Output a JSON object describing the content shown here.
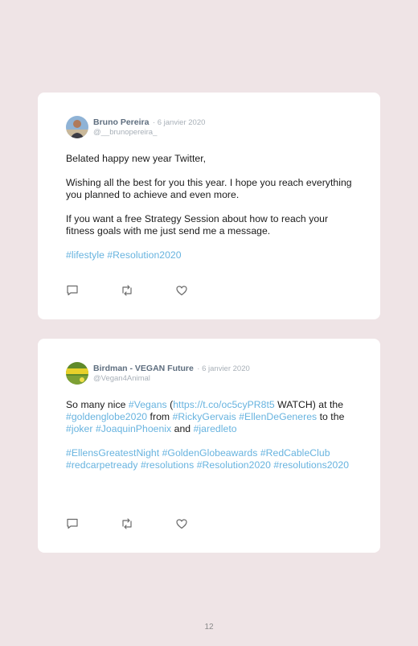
{
  "tweets": [
    {
      "name": "Bruno Pereira",
      "date": "· 6 janvier 2020",
      "handle": "@__brunopereira_",
      "paragraphs": [
        [
          {
            "t": "Belated happy new year Twitter,"
          }
        ],
        [
          {
            "t": "Wishing all the best for you this year. I hope you reach everything you planned to achieve and even more."
          }
        ],
        [
          {
            "t": "If you want a free Strategy Session about how to reach your fitness goals with me just send me a message."
          }
        ],
        [
          {
            "t": "#lifestyle",
            "tag": true
          },
          {
            "t": " "
          },
          {
            "t": "#Resolution2020",
            "tag": true
          }
        ]
      ]
    },
    {
      "name": "Birdman - VEGAN Future",
      "date": "· 6 janvier 2020",
      "handle": "@Vegan4Animal",
      "avatar_text": "VEGAN",
      "paragraphs": [
        [
          {
            "t": "So many nice "
          },
          {
            "t": "#Vegans",
            "tag": true
          },
          {
            "t": " ("
          },
          {
            "t": "https://t.co/oc5cyPR8t5",
            "tag": true
          },
          {
            "t": " WATCH) at the "
          },
          {
            "t": "#goldenglobe2020",
            "tag": true
          },
          {
            "t": " from "
          },
          {
            "t": "#RickyGervais",
            "tag": true
          },
          {
            "t": " "
          },
          {
            "t": "#EllenDeGeneres",
            "tag": true
          },
          {
            "t": " to the "
          },
          {
            "t": "#joker",
            "tag": true
          },
          {
            "t": " "
          },
          {
            "t": "#JoaquinPhoenix",
            "tag": true
          },
          {
            "t": " and "
          },
          {
            "t": "#jaredleto",
            "tag": true
          }
        ],
        [
          {
            "t": "#EllensGreatestNight",
            "tag": true
          },
          {
            "t": " "
          },
          {
            "t": "#GoldenGlobeawards",
            "tag": true
          },
          {
            "t": " "
          },
          {
            "t": "#RedCableClub",
            "tag": true
          },
          {
            "t": " "
          },
          {
            "t": "#redcarpetready",
            "tag": true
          },
          {
            "t": " "
          },
          {
            "t": "#resolutions",
            "tag": true
          },
          {
            "t": " "
          },
          {
            "t": "#Resolution2020",
            "tag": true
          },
          {
            "t": " "
          },
          {
            "t": "#resolutions2020",
            "tag": true
          }
        ]
      ]
    }
  ],
  "icons": [
    "reply-icon",
    "retweet-icon",
    "like-icon"
  ],
  "colors": {
    "background": "#efe4e6",
    "hashtag": "#67b3df",
    "name": "#5e6e7f",
    "meta": "#a8b0b8"
  },
  "page_number": "12"
}
